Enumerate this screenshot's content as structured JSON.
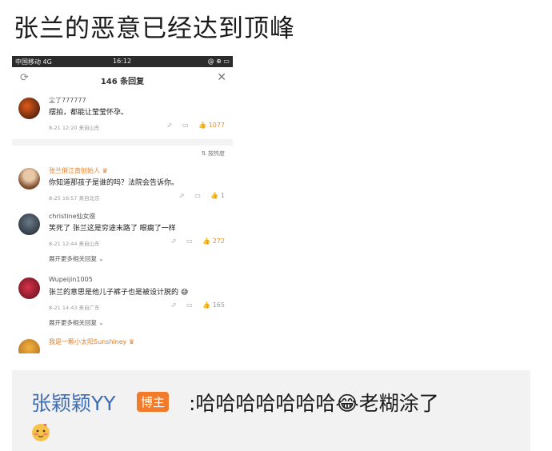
{
  "title": "张兰的恶意已经达到顶峰",
  "status_bar": {
    "carrier": "中国移动 4G",
    "time": "16:12",
    "right": "@ ⊕ ▭"
  },
  "sheet": {
    "count_label": "146 条回复"
  },
  "sort_label": "⇅ 按热度",
  "comments": [
    {
      "name": "尘了777777",
      "text": "摆拍，都能让莹莹怀孕。",
      "meta": "8-21 12:20 来自山东",
      "likes": "1077"
    },
    {
      "name": "张兰俏江南创始人",
      "text": "你知道那孩子是谁的吗？法院会告诉你。",
      "meta": "8-25 16:57 来自北京",
      "likes": "1"
    },
    {
      "name": "christine仙女座",
      "text": "笑死了 张兰这是穷途末路了 眼瘸了一样",
      "meta": "8-21 12:44 来自山东",
      "likes": "272",
      "more": "展开更多相关回复 ⌄"
    },
    {
      "name": "Wupeijin1005",
      "text": "张兰的意思是他儿子裤子也是被设计脱的",
      "meta": "8-21 14:43 来自广东",
      "likes": "165",
      "more": "展开更多相关回复 ⌄"
    },
    {
      "name": "我是一颗小太阳Sunshiney"
    }
  ],
  "bottom": {
    "name": "张颖颖YY",
    "badge": "博主",
    "text": ":哈哈哈哈哈哈哈😂老糊涂了"
  },
  "colors": {
    "accent": "#f08a24",
    "link": "#3f6fb0",
    "badge": "#f27b2b"
  }
}
